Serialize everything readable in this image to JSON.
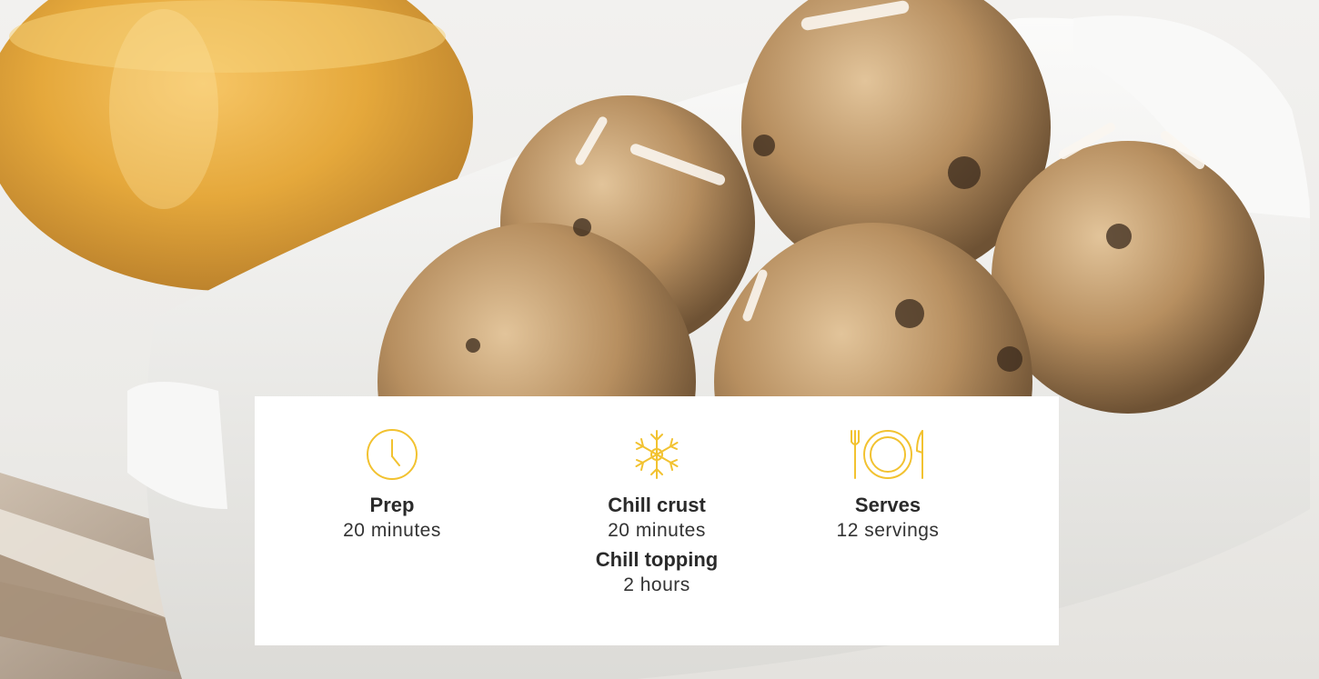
{
  "recipe_info": {
    "prep": {
      "label": "Prep",
      "value": "20 minutes",
      "icon": "clock-icon"
    },
    "chill": {
      "label": "Chill crust",
      "value": "20 minutes",
      "second_label": "Chill topping",
      "second_value": "2 hours",
      "icon": "snowflake-icon"
    },
    "serves": {
      "label": "Serves",
      "value": "12 servings",
      "icon": "plate-utensils-icon"
    }
  },
  "colors": {
    "icon_accent": "#f2c230",
    "text_dark": "#2a2a2a",
    "card_bg": "#ffffff"
  }
}
